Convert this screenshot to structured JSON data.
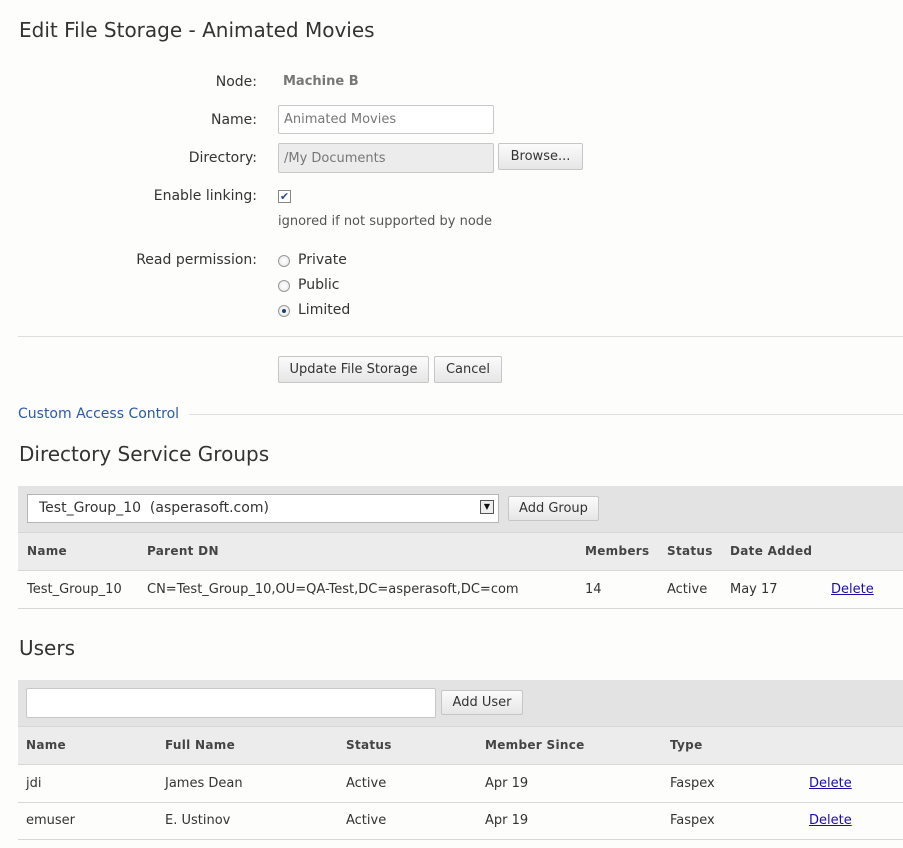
{
  "page": {
    "title": "Edit File Storage - Animated Movies"
  },
  "form": {
    "node_label": "Node:",
    "node_value": "Machine B",
    "name_label": "Name:",
    "name_value": "Animated Movies",
    "directory_label": "Directory:",
    "directory_value": "/My Documents",
    "browse_label": "Browse...",
    "linking_label": "Enable linking:",
    "linking_checked": true,
    "linking_hint": "ignored if not supported by node",
    "permission_label": "Read permission:",
    "permission_options": [
      "Private",
      "Public",
      "Limited"
    ],
    "permission_selected": "Limited",
    "update_label": "Update File Storage",
    "cancel_label": "Cancel"
  },
  "access_control": {
    "link_label": "Custom Access Control"
  },
  "groups": {
    "title": "Directory Service Groups",
    "select_value": "Test_Group_10  (asperasoft.com)",
    "add_label": "Add Group",
    "columns": [
      "Name",
      "Parent DN",
      "Members",
      "Status",
      "Date Added"
    ],
    "rows": [
      {
        "name": "Test_Group_10",
        "parent_dn": "CN=Test_Group_10,OU=QA-Test,DC=asperasoft,DC=com",
        "members": "14",
        "status": "Active",
        "date_added": "May 17",
        "delete_label": "Delete"
      }
    ]
  },
  "users": {
    "title": "Users",
    "search_value": "",
    "add_label": "Add User",
    "columns": [
      "Name",
      "Full Name",
      "Status",
      "Member Since",
      "Type"
    ],
    "rows": [
      {
        "name": "jdi",
        "full_name": "James Dean",
        "status": "Active",
        "member_since": "Apr 19",
        "type": "Faspex",
        "delete_label": "Delete"
      },
      {
        "name": "emuser",
        "full_name": "E. Ustinov",
        "status": "Active",
        "member_since": "Apr 19",
        "type": "Faspex",
        "delete_label": "Delete"
      }
    ]
  },
  "icons": {
    "checkbox_check": "check-icon",
    "select_arrow": "chevron-down-icon"
  },
  "colors": {
    "link": "#2b5aa6",
    "delete_link": "#1a0dab",
    "toolbar_bg": "#e3e3e3"
  }
}
